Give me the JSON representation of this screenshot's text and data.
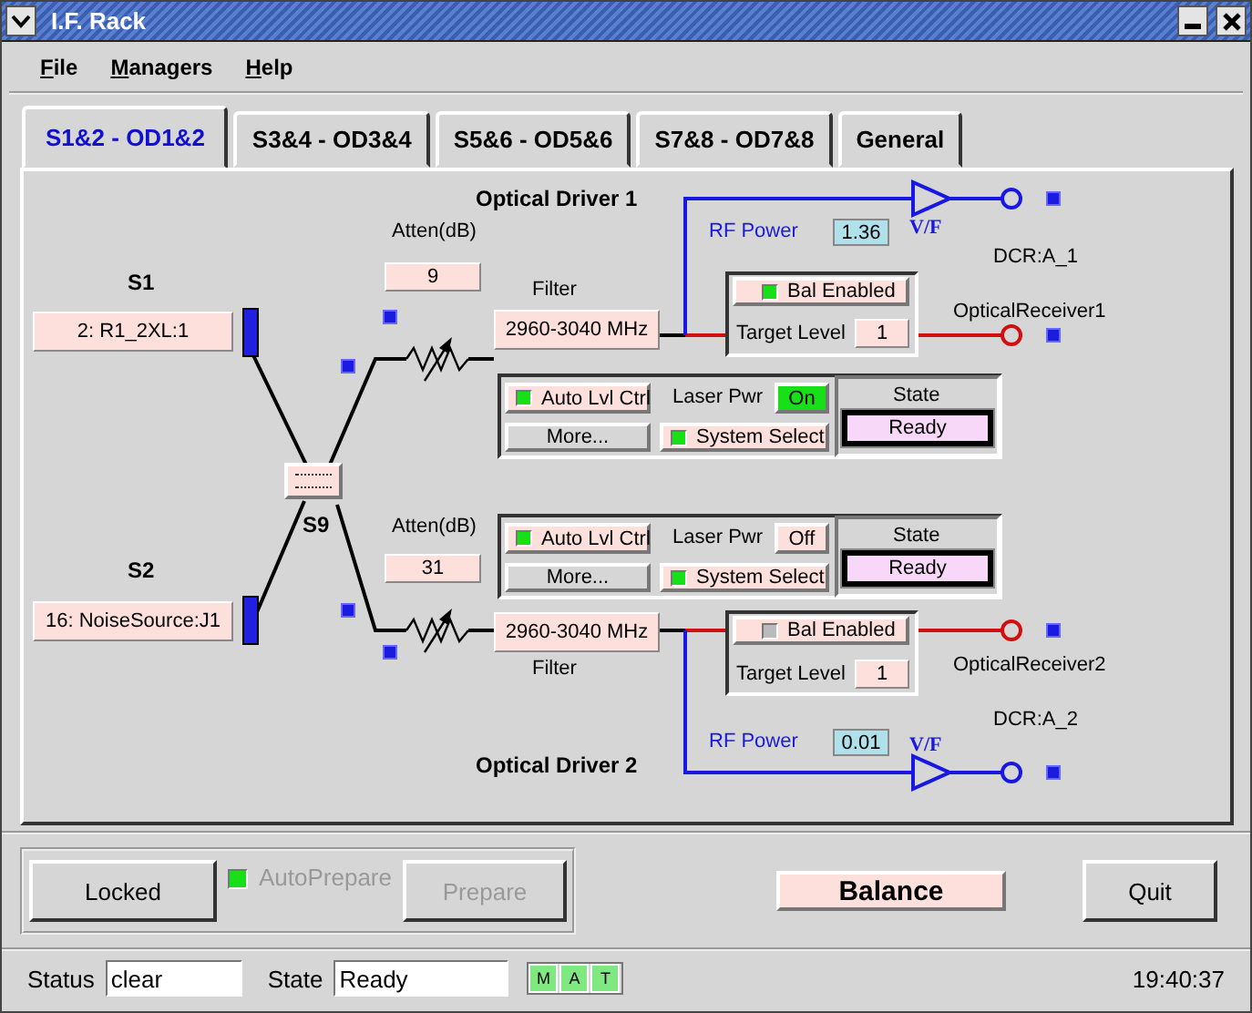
{
  "window": {
    "title": "I.F. Rack"
  },
  "menu": [
    {
      "label": "File"
    },
    {
      "label": "Managers"
    },
    {
      "label": "Help"
    }
  ],
  "tabs": [
    {
      "label": "S1&2 - OD1&2",
      "selected": true
    },
    {
      "label": "S3&4 - OD3&4",
      "selected": false
    },
    {
      "label": "S5&6 - OD5&6",
      "selected": false
    },
    {
      "label": "S7&8 - OD7&8",
      "selected": false
    },
    {
      "label": "General",
      "selected": false
    }
  ],
  "switches": [
    {
      "label": "S1",
      "value": "2: R1_2XL:1"
    },
    {
      "label": "S2",
      "value": "16: NoiseSource:J1"
    }
  ],
  "combiner": {
    "label": "S9"
  },
  "drivers": [
    {
      "title": "Optical Driver 1",
      "atten_label": "Atten(dB)",
      "atten": "9",
      "filter_label": "Filter",
      "filter": "2960-3040 MHz",
      "rf_power_label": "RF Power",
      "rf_power": "1.36",
      "vf_label": "V/F",
      "dcr": "DCR:A_1",
      "receiver": "OpticalReceiver1",
      "bal_enabled": {
        "label": "Bal Enabled",
        "checked": true
      },
      "target_level_label": "Target Level",
      "target_level": "1",
      "auto_lvl": {
        "label": "Auto Lvl Ctrl",
        "checked": true
      },
      "laser_pwr_label": "Laser Pwr",
      "laser_pwr": {
        "text": "On",
        "on": true
      },
      "more": "More...",
      "system_select": {
        "label": "System Select",
        "checked": true
      },
      "state_label": "State",
      "state": "Ready"
    },
    {
      "title": "Optical Driver 2",
      "atten_label": "Atten(dB)",
      "atten": "31",
      "filter_label": "Filter",
      "filter": "2960-3040 MHz",
      "rf_power_label": "RF Power",
      "rf_power": "0.01",
      "vf_label": "V/F",
      "dcr": "DCR:A_2",
      "receiver": "OpticalReceiver2",
      "bal_enabled": {
        "label": "Bal Enabled",
        "checked": false
      },
      "target_level_label": "Target Level",
      "target_level": "1",
      "auto_lvl": {
        "label": "Auto Lvl Ctrl",
        "checked": true
      },
      "laser_pwr_label": "Laser Pwr",
      "laser_pwr": {
        "text": "Off",
        "on": false
      },
      "more": "More...",
      "system_select": {
        "label": "System Select",
        "checked": true
      },
      "state_label": "State",
      "state": "Ready"
    }
  ],
  "footer": {
    "locked": "Locked",
    "auto_prepare": {
      "label": "AutoPrepare",
      "checked": true,
      "disabled": true
    },
    "prepare": {
      "label": "Prepare",
      "disabled": true
    },
    "balance": "Balance",
    "quit": "Quit"
  },
  "status_bar": {
    "status_label": "Status",
    "status": "clear",
    "state_label": "State",
    "state": "Ready",
    "indicators": [
      {
        "label": "M",
        "on": true
      },
      {
        "label": "A",
        "on": true
      },
      {
        "label": "T",
        "on": true
      }
    ],
    "time": "19:40:37"
  }
}
